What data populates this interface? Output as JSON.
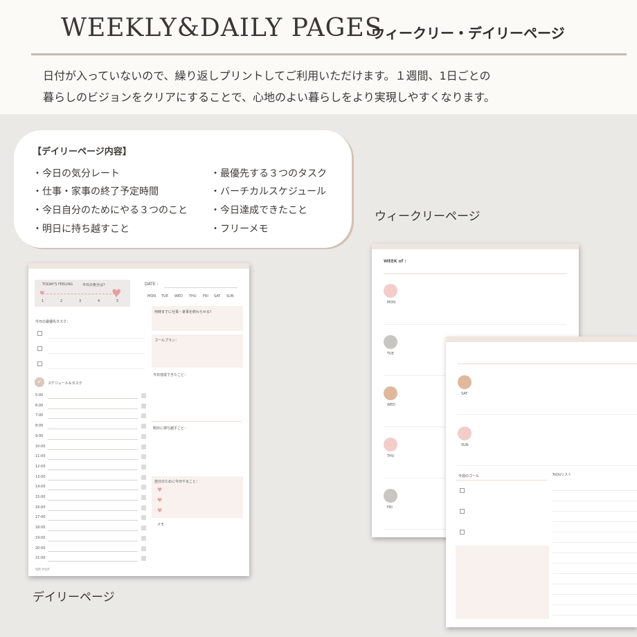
{
  "header": {
    "title_en": "WEEKLY&DAILY PAGES",
    "title_jp": "ウィークリー・デイリーページ",
    "intro_lines": [
      "日付が入っていないので、繰り返しプリントしてご利用いただけます。１週間、1日ごとの",
      "暮らしのビジョンをクリアにすることで、心地のよい暮らしをより実現しやすくなります。"
    ]
  },
  "bubble": {
    "title": "【デイリーページ内容】",
    "left_items": [
      "・今日の気分レート",
      "・仕事・家事の終了予定時間",
      "・今日自分のためにやる３つのこと",
      "・明日に持ち越すこと"
    ],
    "right_items": [
      "・最優先する３つのタスク",
      "・バーチカルスケジュール",
      "・今日達成できたこと",
      "・フリーメモ"
    ]
  },
  "captions": {
    "weekly": "ウィークリーページ",
    "daily": "デイリーページ"
  },
  "daily_sheet": {
    "feeling_title": "TODAY'S FEELING",
    "feeling_sub": "今日の気分は？",
    "ratings": [
      "1",
      "2",
      "3",
      "4",
      "5"
    ],
    "date_label": "DATE :",
    "days": [
      "MON",
      "TUE",
      "WED",
      "THU",
      "FRI",
      "SAT",
      "SUN"
    ],
    "priority_label": "今日の最優先タスク：",
    "schedule_label": "スケジュール＆タスク",
    "times": [
      "5:00",
      "6:00",
      "7:00",
      "8:00",
      "9:00",
      "10:00",
      "11:00",
      "12:00",
      "13:00",
      "14:00",
      "15:00",
      "16:00",
      "17:00",
      "18:00",
      "19:00",
      "20:00",
      "21:00"
    ],
    "box1_label": "何時までに仕事・家事を終わらせる？",
    "box2_label": "ゴールプラン：",
    "achieved_label": "今日達成できたこと：",
    "carry_label": "明日に持ち越すこと：",
    "self_label": "自分のために今日やること：",
    "memo_label": "メモ",
    "brand": "WE-HUP"
  },
  "weekly_sheet": {
    "week_of_label": "WEEK of :",
    "days": [
      {
        "label": "MON",
        "color": "#f2cdca"
      },
      {
        "label": "TUE",
        "color": "#c8c6c0"
      },
      {
        "label": "WED",
        "color": "#dfb89d"
      },
      {
        "label": "THU",
        "color": "#f2cdca"
      },
      {
        "label": "FRI",
        "color": "#c8c6c0"
      }
    ]
  },
  "weekly_sheet2": {
    "days": [
      {
        "label": "SAT",
        "color": "#dfb89d"
      },
      {
        "label": "SUN",
        "color": "#f2cdca"
      }
    ],
    "goal_label": "今週のゴール",
    "todo_label": "ToDoリスト"
  }
}
